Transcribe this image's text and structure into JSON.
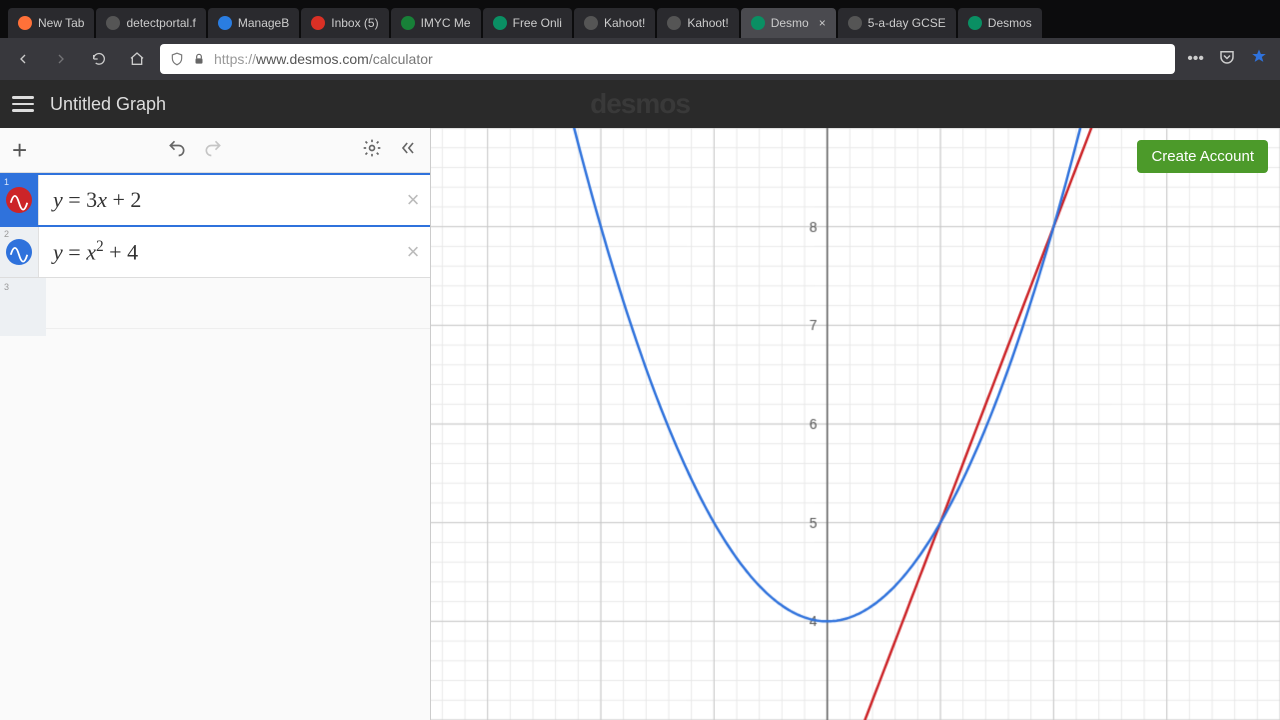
{
  "browser": {
    "tabs": [
      {
        "label": "New Tab",
        "favicon": "#ff7139"
      },
      {
        "label": "detectportal.f",
        "favicon": "#555"
      },
      {
        "label": "ManageB",
        "favicon": "#2a7de1"
      },
      {
        "label": "Inbox (5)",
        "favicon": "#d93025"
      },
      {
        "label": "IMYC Me",
        "favicon": "#188038"
      },
      {
        "label": "Free Onli",
        "favicon": "#0a8f63"
      },
      {
        "label": "Kahoot!",
        "favicon": "#555"
      },
      {
        "label": "Kahoot!",
        "favicon": "#555"
      },
      {
        "label": "Desmo",
        "favicon": "#0a8f63",
        "active": true
      },
      {
        "label": "5-a-day GCSE",
        "favicon": "#555"
      },
      {
        "label": "Desmos",
        "favicon": "#0a8f63"
      }
    ],
    "url_proto": "https://",
    "url_host": "www.desmos.com",
    "url_path": "/calculator"
  },
  "app": {
    "title": "Untitled Graph",
    "logo": "desmos",
    "cta": "Create Account",
    "expressions": [
      {
        "idx": "1",
        "latex": "y = 3x + 2",
        "color": "#cc2428",
        "active": true
      },
      {
        "idx": "2",
        "latex": "y = x² + 4",
        "color": "#2f72dc",
        "active": false
      }
    ],
    "empty_idx": "3"
  },
  "chart_data": {
    "type": "line",
    "xlabel": "",
    "ylabel": "",
    "xlim": [
      -3.5,
      4
    ],
    "ylim": [
      3,
      9
    ],
    "y_ticks": [
      4,
      5,
      6,
      7,
      8
    ],
    "gridlines_minor": 0.2,
    "gridlines_major": 1,
    "series": [
      {
        "name": "y = 3x + 2",
        "color": "#cc2428",
        "kind": "line",
        "slope": 3,
        "intercept": 2
      },
      {
        "name": "y = x^2 + 4",
        "color": "#2f72dc",
        "kind": "parabola",
        "a": 1,
        "b": 0,
        "c": 4
      }
    ],
    "intersections": [
      {
        "x": 1,
        "y": 5
      },
      {
        "x": 2,
        "y": 8
      }
    ]
  }
}
